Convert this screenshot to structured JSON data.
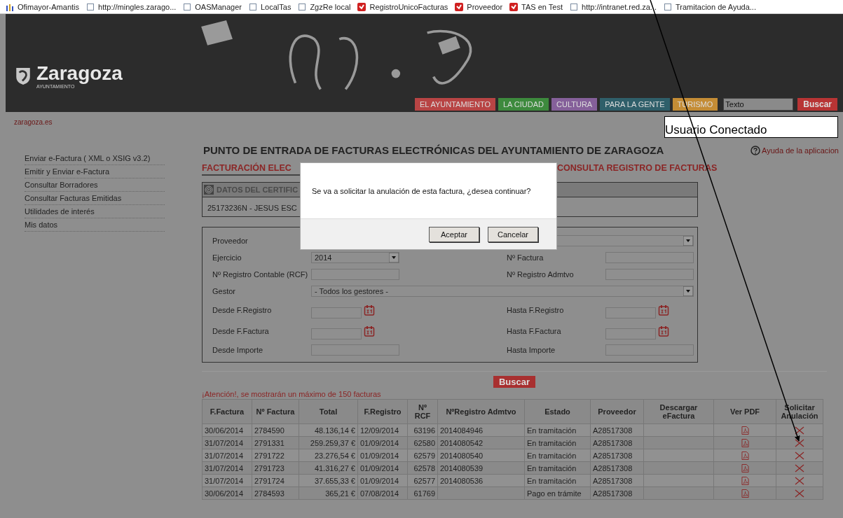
{
  "bookmarks": [
    {
      "label": "Ofimayor-Amantis",
      "kind": "bars"
    },
    {
      "label": "http://mingles.zarago...",
      "kind": "page"
    },
    {
      "label": "OASManager",
      "kind": "page"
    },
    {
      "label": "LocalTas",
      "kind": "page"
    },
    {
      "label": "ZgzRe local",
      "kind": "page"
    },
    {
      "label": "RegistroUnicoFacturas",
      "kind": "app"
    },
    {
      "label": "Proveedor",
      "kind": "app"
    },
    {
      "label": "TAS en Test",
      "kind": "app"
    },
    {
      "label": "http://intranet.red.za...",
      "kind": "page"
    },
    {
      "label": "Tramitacion de Ayuda...",
      "kind": "page"
    }
  ],
  "header": {
    "logo": "Zaragoza",
    "logo_sub": "AYUNTAMIENTO",
    "nav": [
      {
        "label": "EL AYUNTAMIENTO",
        "color": "#b84444"
      },
      {
        "label": "LA CIUDAD",
        "color": "#3d8a3d"
      },
      {
        "label": "CULTURA",
        "color": "#85609a"
      },
      {
        "label": "PARA LA GENTE",
        "color": "#2f5f6a"
      },
      {
        "label": "TURISMO",
        "color": "#c48c35"
      }
    ],
    "search_value": "Texto",
    "search_button": "Buscar"
  },
  "site_link": "zaragoza.es",
  "user_box": "Usuario Conectado",
  "sidebar": {
    "items": [
      "Enviar e-Factura ( XML o XSIG v3.2)",
      "Emitir y Enviar e-Factura",
      "Consultar Borradores",
      "Consultar Facturas Emitidas",
      "Utilidades de interés",
      "Mis datos"
    ]
  },
  "title": "PUNTO DE ENTRADA DE FACTURAS ELECTRÓNICAS DEL AYUNTAMIENTO DE ZARAGOZA",
  "help": "Ayuda de la aplicacion",
  "tabs": [
    {
      "label": "FACTURACIÓN ELEC",
      "selected": true
    },
    {
      "label": "CONSULTA REGISTRO DE FACTURAS",
      "selected": false
    }
  ],
  "certificate": {
    "title": "DATOS DEL CERTIFIC",
    "value": "25173236N - JESUS ESC"
  },
  "filters": [
    {
      "label": "Proveedor",
      "kind": "wide"
    },
    {
      "label": "Ejercicio",
      "kind": "select",
      "value": "2014"
    },
    {
      "label": "Nº Factura",
      "kind": "text"
    },
    {
      "label": "Nº Registro Contable (RCF)",
      "kind": "text"
    },
    {
      "label": "Nº Registro Admtvo",
      "kind": "text"
    },
    {
      "label": "Gestor",
      "kind": "wide",
      "value": "- Todos los gestores -"
    },
    {
      "label": "Desde F.Registro",
      "kind": "date"
    },
    {
      "label": "Hasta F.Registro",
      "kind": "date"
    },
    {
      "label": "Desde F.Factura",
      "kind": "date"
    },
    {
      "label": "Hasta F.Factura",
      "kind": "date"
    },
    {
      "label": "Desde Importe",
      "kind": "text"
    },
    {
      "label": "Hasta Importe",
      "kind": "text"
    }
  ],
  "search_button": "Buscar",
  "warning": "¡Atención!, se mostrarán un máximo de 150 facturas",
  "table": {
    "columns": [
      "F.Factura",
      "Nº Factura",
      "Total",
      "F.Registro",
      "Nº RCF",
      "NºRegistro Admtvo",
      "Estado",
      "Proveedor",
      "Descargar eFactura",
      "Ver PDF",
      "Solicitar Anulación"
    ],
    "rows": [
      {
        "f_factura": "30/06/2014",
        "n_factura": "2784590",
        "total": "48.136,14 €",
        "f_registro": "12/09/2014",
        "n_rcf": "63196",
        "n_registro": "2014084946",
        "estado": "En tramitación",
        "proveedor": "A28517308"
      },
      {
        "f_factura": "31/07/2014",
        "n_factura": "2791331",
        "total": "259.259,37 €",
        "f_registro": "01/09/2014",
        "n_rcf": "62580",
        "n_registro": "2014080542",
        "estado": "En tramitación",
        "proveedor": "A28517308"
      },
      {
        "f_factura": "31/07/2014",
        "n_factura": "2791722",
        "total": "23.276,54 €",
        "f_registro": "01/09/2014",
        "n_rcf": "62579",
        "n_registro": "2014080540",
        "estado": "En tramitación",
        "proveedor": "A28517308"
      },
      {
        "f_factura": "31/07/2014",
        "n_factura": "2791723",
        "total": "41.316,27 €",
        "f_registro": "01/09/2014",
        "n_rcf": "62578",
        "n_registro": "2014080539",
        "estado": "En tramitación",
        "proveedor": "A28517308"
      },
      {
        "f_factura": "31/07/2014",
        "n_factura": "2791724",
        "total": "37.655,33 €",
        "f_registro": "01/09/2014",
        "n_rcf": "62577",
        "n_registro": "2014080536",
        "estado": "En tramitación",
        "proveedor": "A28517308"
      },
      {
        "f_factura": "30/06/2014",
        "n_factura": "2784593",
        "total": "365,21 €",
        "f_registro": "07/08/2014",
        "n_rcf": "61769",
        "estado": "Pago en trámite",
        "proveedor": "A28517308"
      }
    ]
  },
  "dialog": {
    "message": "Se va a solicitar la anulación de esta factura, ¿desea continuar?",
    "buttons": [
      "Aceptar",
      "Cancelar"
    ]
  }
}
